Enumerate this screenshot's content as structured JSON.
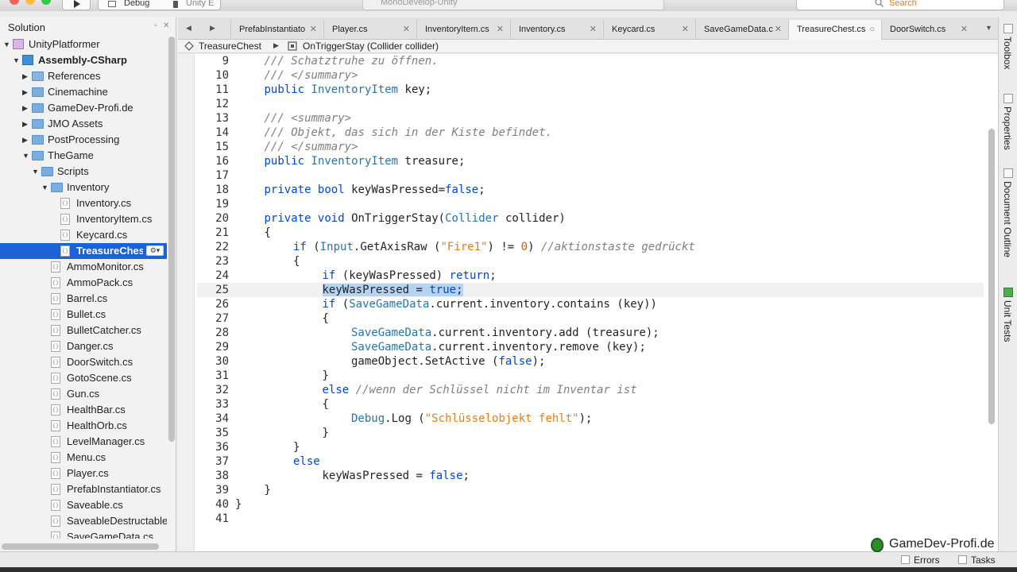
{
  "toolbar": {
    "config_label": "Debug",
    "target_label": "Unity E",
    "app_title": "MonoDevelop-Unity",
    "search_placeholder": "Search",
    "traffic_colors": [
      "#fc605c",
      "#fdbc40",
      "#34c84a"
    ]
  },
  "solution": {
    "title": "Solution",
    "items": [
      {
        "label": "UnityPlatformer",
        "type": "sol",
        "level": 0,
        "expand": "open"
      },
      {
        "label": "Assembly-CSharp",
        "type": "proj",
        "level": 1,
        "expand": "open",
        "bold": true
      },
      {
        "label": "References",
        "type": "ref",
        "level": 2,
        "expand": "closed"
      },
      {
        "label": "Cinemachine",
        "type": "folder",
        "level": 2,
        "expand": "closed"
      },
      {
        "label": "GameDev-Profi.de",
        "type": "folder",
        "level": 2,
        "expand": "closed"
      },
      {
        "label": "JMO Assets",
        "type": "folder",
        "level": 2,
        "expand": "closed"
      },
      {
        "label": "PostProcessing",
        "type": "folder",
        "level": 2,
        "expand": "closed"
      },
      {
        "label": "TheGame",
        "type": "folder",
        "level": 2,
        "expand": "open"
      },
      {
        "label": "Scripts",
        "type": "folder",
        "level": 3,
        "expand": "open"
      },
      {
        "label": "Inventory",
        "type": "folder",
        "level": 4,
        "expand": "open"
      },
      {
        "label": "Inventory.cs",
        "type": "file",
        "level": 5
      },
      {
        "label": "InventoryItem.cs",
        "type": "file",
        "level": 5
      },
      {
        "label": "Keycard.cs",
        "type": "file",
        "level": 5
      },
      {
        "label": "TreasureChest.cs",
        "type": "file",
        "level": 5,
        "selected": true
      },
      {
        "label": "AmmoMonitor.cs",
        "type": "file",
        "level": 4
      },
      {
        "label": "AmmoPack.cs",
        "type": "file",
        "level": 4
      },
      {
        "label": "Barrel.cs",
        "type": "file",
        "level": 4
      },
      {
        "label": "Bullet.cs",
        "type": "file",
        "level": 4
      },
      {
        "label": "BulletCatcher.cs",
        "type": "file",
        "level": 4
      },
      {
        "label": "Danger.cs",
        "type": "file",
        "level": 4
      },
      {
        "label": "DoorSwitch.cs",
        "type": "file",
        "level": 4
      },
      {
        "label": "GotoScene.cs",
        "type": "file",
        "level": 4
      },
      {
        "label": "Gun.cs",
        "type": "file",
        "level": 4
      },
      {
        "label": "HealthBar.cs",
        "type": "file",
        "level": 4
      },
      {
        "label": "HealthOrb.cs",
        "type": "file",
        "level": 4
      },
      {
        "label": "LevelManager.cs",
        "type": "file",
        "level": 4
      },
      {
        "label": "Menu.cs",
        "type": "file",
        "level": 4
      },
      {
        "label": "Player.cs",
        "type": "file",
        "level": 4
      },
      {
        "label": "PrefabInstantiator.cs",
        "type": "file",
        "level": 4
      },
      {
        "label": "Saveable.cs",
        "type": "file",
        "level": 4
      },
      {
        "label": "SaveableDestructable",
        "type": "file",
        "level": 4
      },
      {
        "label": "SaveGameData.cs",
        "type": "file",
        "level": 4
      }
    ]
  },
  "tabs": [
    {
      "label": "PrefabInstantiato"
    },
    {
      "label": "Player.cs"
    },
    {
      "label": "InventoryItem.cs"
    },
    {
      "label": "Inventory.cs"
    },
    {
      "label": "Keycard.cs"
    },
    {
      "label": "SaveGameData.c"
    },
    {
      "label": "TreasureChest.cs",
      "active": true
    },
    {
      "label": "DoorSwitch.cs"
    }
  ],
  "breadcrumb": {
    "class_name": "TreasureChest",
    "member_name": "OnTriggerStay (Collider collider)"
  },
  "editor": {
    "current_line": 25,
    "lines": [
      {
        "n": "9",
        "t": [
          [
            "cm",
            "/// Schatztruhe zu öffnen."
          ]
        ],
        "indent": 1
      },
      {
        "n": "10",
        "t": [
          [
            "cm",
            "/// </summary>"
          ]
        ],
        "indent": 1
      },
      {
        "n": "11",
        "t": [
          [
            "kw",
            "public "
          ],
          [
            "ty",
            "InventoryItem"
          ],
          [
            "pl",
            " key;"
          ]
        ],
        "indent": 1
      },
      {
        "n": "12",
        "t": [],
        "indent": 1
      },
      {
        "n": "13",
        "t": [
          [
            "cm",
            "/// <summary>"
          ]
        ],
        "indent": 1
      },
      {
        "n": "14",
        "t": [
          [
            "cm",
            "/// Objekt, das sich in der Kiste befindet."
          ]
        ],
        "indent": 1
      },
      {
        "n": "15",
        "t": [
          [
            "cm",
            "/// </summary>"
          ]
        ],
        "indent": 1
      },
      {
        "n": "16",
        "t": [
          [
            "kw",
            "public "
          ],
          [
            "ty",
            "InventoryItem"
          ],
          [
            "pl",
            " treasure;"
          ]
        ],
        "indent": 1
      },
      {
        "n": "17",
        "t": [],
        "indent": 1
      },
      {
        "n": "18",
        "t": [
          [
            "kw",
            "private bool "
          ],
          [
            "pl",
            "keyWasPressed="
          ],
          [
            "kw",
            "false"
          ],
          [
            "pl",
            ";"
          ]
        ],
        "indent": 1
      },
      {
        "n": "19",
        "t": [],
        "indent": 1
      },
      {
        "n": "20",
        "t": [
          [
            "kw",
            "private void "
          ],
          [
            "pl",
            "OnTriggerStay("
          ],
          [
            "ty",
            "Collider"
          ],
          [
            "pl",
            " collider)"
          ]
        ],
        "indent": 1
      },
      {
        "n": "21",
        "t": [
          [
            "pl",
            "{"
          ]
        ],
        "indent": 1
      },
      {
        "n": "22",
        "t": [
          [
            "kw",
            "if "
          ],
          [
            "pl",
            "("
          ],
          [
            "ty",
            "Input"
          ],
          [
            "pl",
            ".GetAxisRaw ("
          ],
          [
            "st",
            "\"Fire1\""
          ],
          [
            "pl",
            ") != "
          ],
          [
            "nu",
            "0"
          ],
          [
            "pl",
            ") "
          ],
          [
            "cm",
            "//aktionstaste gedrückt"
          ]
        ],
        "indent": 2
      },
      {
        "n": "23",
        "t": [
          [
            "pl",
            "{"
          ]
        ],
        "indent": 2
      },
      {
        "n": "24",
        "t": [
          [
            "kw",
            "if "
          ],
          [
            "pl",
            "(keyWasPressed) "
          ],
          [
            "kw",
            "return"
          ],
          [
            "pl",
            ";"
          ]
        ],
        "indent": 3
      },
      {
        "n": "25",
        "t": [
          [
            "sel",
            "keyWasPressed = "
          ],
          [
            "selkw",
            "true"
          ],
          [
            "sel",
            ";"
          ]
        ],
        "indent": 3
      },
      {
        "n": "26",
        "t": [
          [
            "kw",
            "if "
          ],
          [
            "pl",
            "("
          ],
          [
            "ty",
            "SaveGameData"
          ],
          [
            "pl",
            ".current.inventory.contains (key))"
          ]
        ],
        "indent": 3
      },
      {
        "n": "27",
        "t": [
          [
            "pl",
            "{"
          ]
        ],
        "indent": 3
      },
      {
        "n": "28",
        "t": [
          [
            "ty",
            "SaveGameData"
          ],
          [
            "pl",
            ".current.inventory.add (treasure);"
          ]
        ],
        "indent": 4
      },
      {
        "n": "29",
        "t": [
          [
            "ty",
            "SaveGameData"
          ],
          [
            "pl",
            ".current.inventory.remove (key);"
          ]
        ],
        "indent": 4
      },
      {
        "n": "30",
        "t": [
          [
            "pl",
            "gameObject.SetActive ("
          ],
          [
            "kw",
            "false"
          ],
          [
            "pl",
            ");"
          ]
        ],
        "indent": 4
      },
      {
        "n": "31",
        "t": [
          [
            "pl",
            "}"
          ]
        ],
        "indent": 3
      },
      {
        "n": "32",
        "t": [
          [
            "kw",
            "else "
          ],
          [
            "cm",
            "//wenn der Schlüssel nicht im Inventar ist"
          ]
        ],
        "indent": 3
      },
      {
        "n": "33",
        "t": [
          [
            "pl",
            "{"
          ]
        ],
        "indent": 3
      },
      {
        "n": "34",
        "t": [
          [
            "ty",
            "Debug"
          ],
          [
            "pl",
            ".Log ("
          ],
          [
            "st",
            "\"Schlüsselobjekt fehlt\""
          ],
          [
            "pl",
            ");"
          ]
        ],
        "indent": 4
      },
      {
        "n": "35",
        "t": [
          [
            "pl",
            "}"
          ]
        ],
        "indent": 3
      },
      {
        "n": "36",
        "t": [
          [
            "pl",
            "}"
          ]
        ],
        "indent": 2
      },
      {
        "n": "37",
        "t": [
          [
            "kw",
            "else"
          ]
        ],
        "indent": 2
      },
      {
        "n": "38",
        "t": [
          [
            "pl",
            "keyWasPressed = "
          ],
          [
            "kw",
            "false"
          ],
          [
            "pl",
            ";"
          ]
        ],
        "indent": 3
      },
      {
        "n": "39",
        "t": [
          [
            "pl",
            "}"
          ]
        ],
        "indent": 1
      },
      {
        "n": "40",
        "t": [
          [
            "pl",
            "}"
          ]
        ],
        "indent": 0
      },
      {
        "n": "41",
        "t": [],
        "indent": 0
      }
    ]
  },
  "right_dock": [
    {
      "label": "Toolbox",
      "icon": "toolbox-icon"
    },
    {
      "label": "Properties",
      "icon": "properties-icon"
    },
    {
      "label": "Document Outline",
      "icon": "outline-icon"
    },
    {
      "label": "Unit Tests",
      "icon": "unit-tests-icon"
    }
  ],
  "status": {
    "errors_label": "Errors",
    "tasks_label": "Tasks"
  },
  "watermark": {
    "text": "GameDev-Profi.de"
  }
}
